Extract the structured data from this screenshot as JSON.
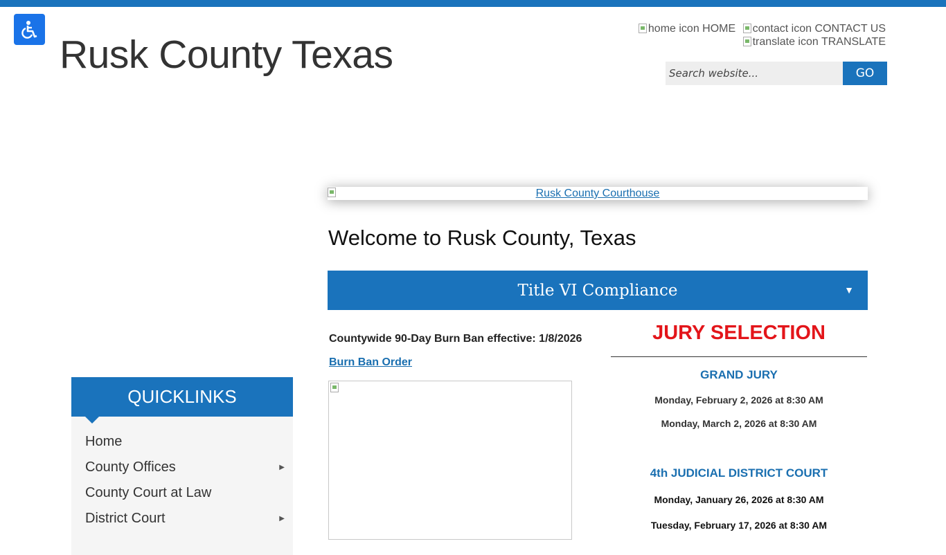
{
  "colors": {
    "accent": "#1a73bc",
    "jury_red": "#e3151a",
    "link_blue": "#1a6fb0"
  },
  "header": {
    "title": "Rusk County Texas",
    "accessibility_icon": "wheelchair-icon",
    "home_alt": "home icon",
    "home_label": "HOME",
    "contact_alt": "contact icon",
    "contact_label": "CONTACT US",
    "translate_alt": "translate icon",
    "translate_label": "TRANSLATE"
  },
  "search": {
    "placeholder": "Search website...",
    "button_label": "GO"
  },
  "main": {
    "banner_link": "Rusk County Courthouse",
    "welcome": "Welcome to Rusk County, Texas",
    "accordion_title": "Title VI Compliance",
    "accordion_arrow": "▼",
    "burn_ban_text": "Countywide 90-Day Burn Ban effective: 1/8/2026",
    "burn_ban_link": "Burn Ban Order"
  },
  "jury": {
    "title": "JURY SELECTION",
    "grand_jury": {
      "heading": "GRAND JURY",
      "dates": [
        "Monday, February 2, 2026 at 8:30 AM",
        "Monday, March 2, 2026 at 8:30 AM"
      ]
    },
    "district_court": {
      "heading": "4th JUDICIAL DISTRICT COURT",
      "dates": [
        "Monday, January 26, 2026 at 8:30 AM",
        "Tuesday, February 17, 2026 at 8:30 AM"
      ]
    }
  },
  "quicklinks": {
    "heading": "QUICKLINKS",
    "items": [
      {
        "label": "Home",
        "submenu": false
      },
      {
        "label": "County Offices",
        "submenu": true
      },
      {
        "label": "County Court at Law",
        "submenu": false
      },
      {
        "label": "District Court",
        "submenu": true
      }
    ]
  }
}
